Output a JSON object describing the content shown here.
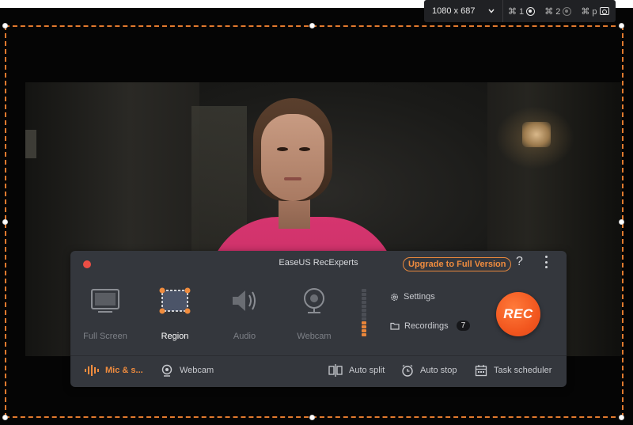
{
  "dimension_bar": {
    "size": "1080 x 687",
    "shortcuts": [
      {
        "key": "⌘ 1",
        "icon": "target-icon"
      },
      {
        "key": "⌘ 2",
        "icon": "target-icon"
      },
      {
        "key": "⌘ p",
        "icon": "camera-icon"
      }
    ]
  },
  "recorder": {
    "title": "EaseUS RecExperts",
    "upgrade_label": "Upgrade to Full Version",
    "help_label": "?",
    "modes": [
      {
        "label": "Full Screen",
        "icon": "monitor-icon",
        "active": false
      },
      {
        "label": "Region",
        "icon": "region-icon",
        "active": true
      },
      {
        "label": "Audio",
        "icon": "speaker-icon",
        "active": false
      },
      {
        "label": "Webcam",
        "icon": "webcam-icon",
        "active": false
      }
    ],
    "settings_label": "Settings",
    "recordings_label": "Recordings",
    "recordings_count": "7",
    "rec_label": "REC",
    "bottom": {
      "mic_label": "Mic & s...",
      "webcam_label": "Webcam",
      "auto_split_label": "Auto split",
      "auto_stop_label": "Auto stop",
      "task_scheduler_label": "Task scheduler"
    }
  },
  "colors": {
    "accent": "#f08c3e",
    "rec": "#f2571f",
    "panel": "#34373d",
    "selection": "#e27a2e"
  }
}
